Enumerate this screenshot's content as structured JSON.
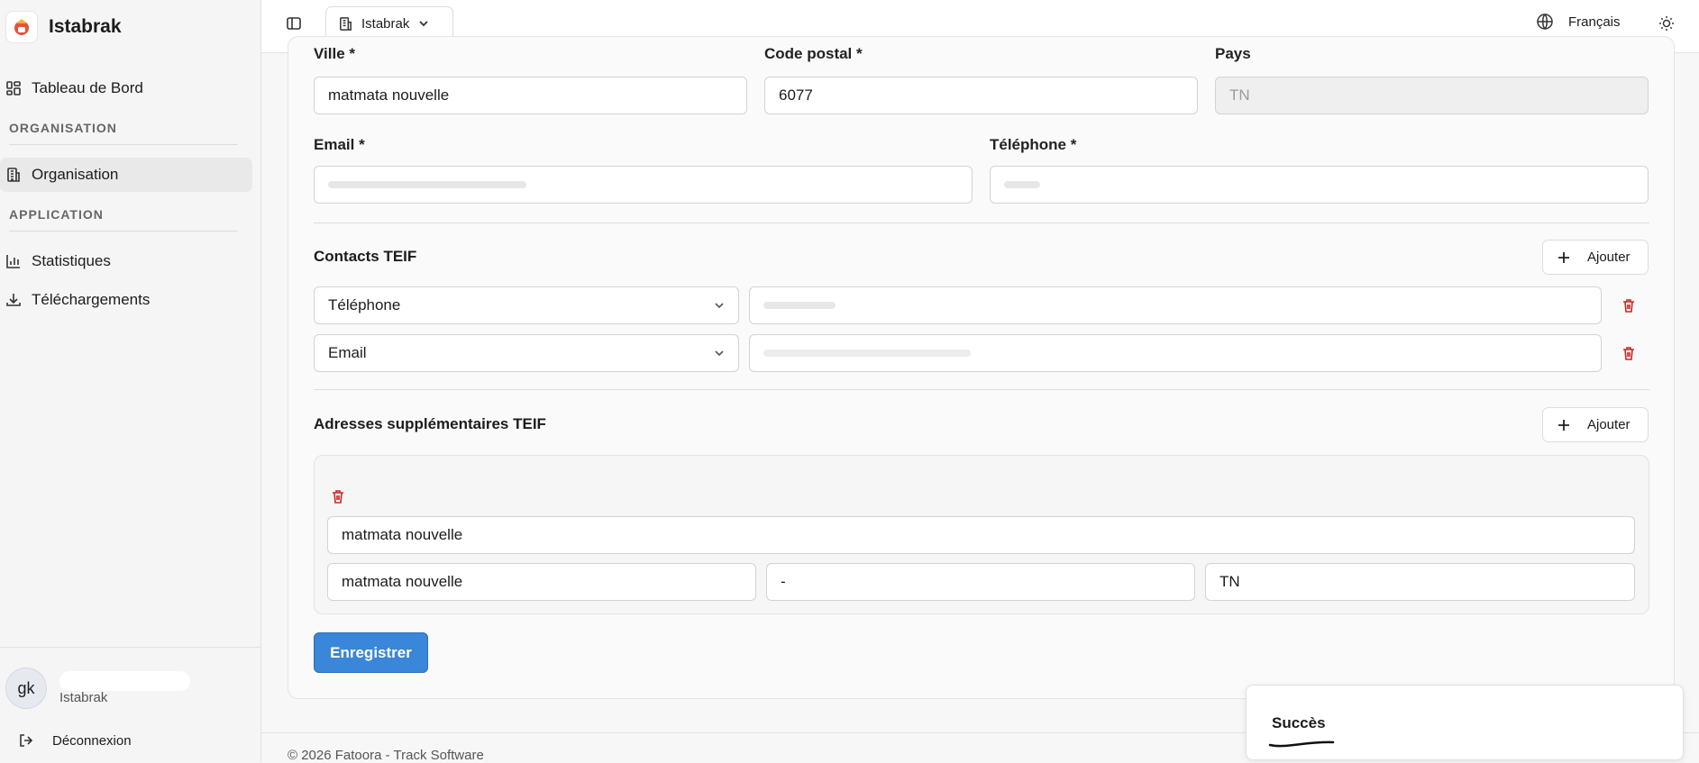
{
  "sidebar": {
    "brand": "Istabrak",
    "nav": {
      "dashboard": "Tableau de Bord",
      "organisation_section": "ORGANISATION",
      "organisation": "Organisation",
      "application_section": "APPLICATION",
      "statistics": "Statistiques",
      "downloads": "Téléchargements"
    },
    "user": {
      "initials": "gk",
      "org": "Istabrak"
    },
    "logout": "Déconnexion"
  },
  "topbar": {
    "org_selected": "Istabrak",
    "language": "Français"
  },
  "form": {
    "city_label": "Ville *",
    "city_value": "matmata nouvelle",
    "postal_label": "Code postal *",
    "postal_value": "6077",
    "country_label": "Pays",
    "country_value": "TN",
    "email_label": "Email *",
    "phone_label": "Téléphone *",
    "contacts_title": "Contacts TEIF",
    "contacts_add": "Ajouter",
    "contacts": [
      {
        "type": "Téléphone"
      },
      {
        "type": "Email"
      }
    ],
    "addresses_title": "Adresses supplémentaires TEIF",
    "addresses_add": "Ajouter",
    "address": {
      "street": "matmata nouvelle",
      "city": "matmata nouvelle",
      "postal": "-",
      "country": "TN"
    },
    "save": "Enregistrer"
  },
  "footer": {
    "copyright": "© 2026 Fatoora - Track Software"
  },
  "toast": {
    "title": "Succès"
  },
  "colors": {
    "primary": "#3a86d8",
    "danger": "#c62828",
    "sidebar_bg": "#f5f5f5"
  }
}
